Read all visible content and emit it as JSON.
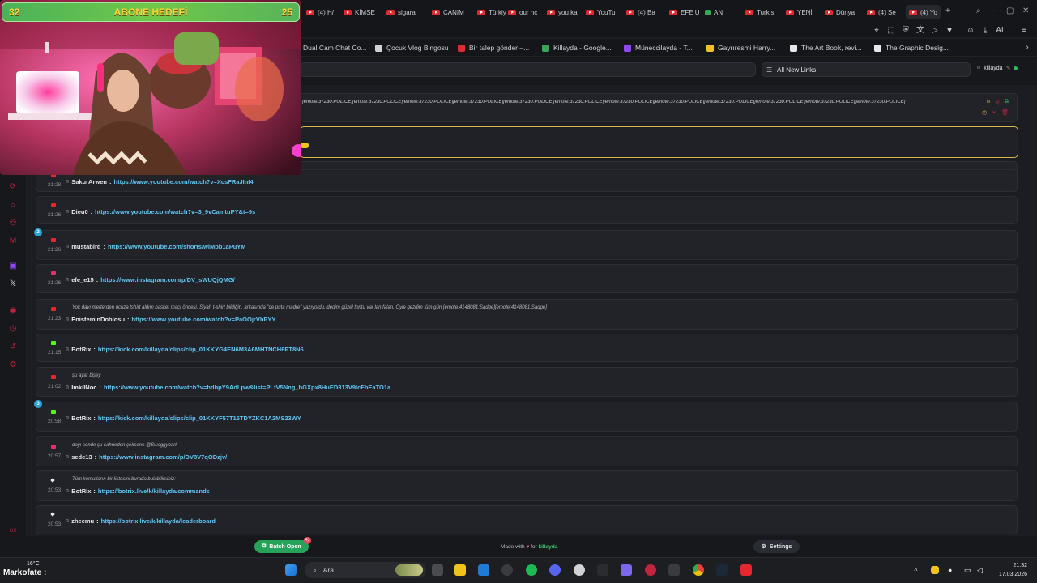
{
  "browser": {
    "tabs": [
      {
        "label": "(4) H/",
        "kind": "yt"
      },
      {
        "label": "KİMSE",
        "kind": "yt"
      },
      {
        "label": "sigara",
        "kind": "yt"
      },
      {
        "label": "CANIM",
        "kind": "yt"
      },
      {
        "label": "Türkiy",
        "kind": "yt"
      },
      {
        "label": "our nc",
        "kind": "yt"
      },
      {
        "label": "you ka",
        "kind": "yt"
      },
      {
        "label": "YouTu",
        "kind": "yt"
      },
      {
        "label": "(4) Ba",
        "kind": "yt"
      },
      {
        "label": "EFE U",
        "kind": "yt"
      },
      {
        "label": "AN",
        "kind": "other"
      },
      {
        "label": "Turkis",
        "kind": "yt"
      },
      {
        "label": "YENİ",
        "kind": "yt"
      },
      {
        "label": "Dünya",
        "kind": "yt"
      },
      {
        "label": "(4) Se",
        "kind": "yt"
      },
      {
        "label": "(4) Yo",
        "kind": "yt",
        "active": true
      }
    ],
    "new_tab": "+",
    "bookmarks": [
      {
        "label": "Dual Cam Chat Co...",
        "color": "#151619"
      },
      {
        "label": "Çocuk Vlog Bingosu",
        "color": "#cfd1d6"
      },
      {
        "label": "Bir talep gönder –...",
        "color": "#e4282d"
      },
      {
        "label": "Killayda - Google...",
        "color": "#34a853"
      },
      {
        "label": "Müneccilayda - T...",
        "color": "#9146ff"
      },
      {
        "label": "Gayrıresmi Harry...",
        "color": "#f0c419"
      },
      {
        "label": "The Art Book, revi...",
        "color": "#e8e8e8"
      },
      {
        "label": "The Graphic Desig...",
        "color": "#e8e8e8"
      }
    ]
  },
  "stream": {
    "goal_label": "ABONE HEDEFİ",
    "goal_current": "32",
    "goal_target": "25"
  },
  "app": {
    "search_placeholder": "",
    "filter_label": "All New Links",
    "username": "killayda",
    "top_card_text": "[emote:37230:POLICE][emote:37230:POLICE][emote:37230:POLICE][emote:37230:POLICE][emote:37230:POLICE][emote:37230:POLICE][emote:37230:POLICE][emote:37230:POLICE][emote:37230:POLICE][emote:37230:POLICE][emote:37230:POLICE][emote:37230:POLICE]",
    "cards": [
      {
        "time": "21:28",
        "user": "SakurArwen",
        "link": "https://www.youtube.com/watch?v=XcsFRaJInI4",
        "src": "yt"
      },
      {
        "time": "21:26",
        "user": "Dieu0",
        "link": "https://www.youtube.com/watch?v=3_9vCamtuPY&t=9s",
        "src": "yt"
      },
      {
        "time": "21:26",
        "user": "mustabird",
        "link": "https://www.youtube.com/shorts/wiMpb1aPuYM",
        "src": "yt",
        "badge": "2"
      },
      {
        "time": "21:26",
        "user": "efe_e15",
        "link": "https://www.instagram.com/p/DV_sWUQjQMG/",
        "src": "ig"
      },
      {
        "time": "21:23",
        "user": "EnistemìnDoblosu",
        "link": "https://www.youtube.com/watch?v=PaOOjrVhPYY",
        "src": "yt",
        "msg": "Yok dayı merterden ucuza tshirt aldım basket maçı öncesi. Siyah t-shirt bildiğin, arkasında \"de puta madre\" yazıyordu. dedim güzel fontu var lan falan. Öyle gezdim tüm gün [emote:4148081:Sadge][emote:4148081:Sadge]"
      },
      {
        "time": "21:15",
        "user": "BotRix",
        "link": "https://kick.com/killayda/clips/clip_01KKYG4EN6M3A6MHTNCH6PT8N6",
        "src": "kick"
      },
      {
        "time": "21:02",
        "user": "ImkiINoc",
        "link": "https://www.youtube.com/watch?v=hdbpY9AdLpw&list=PLtV5Nng_bGXpx8HuED313V9lcFbEaTO1a",
        "src": "yt",
        "msg": "şu ayar bişey"
      },
      {
        "time": "20:58",
        "user": "BotRix",
        "link": "https://kick.com/killayda/clips/clip_01KKYF57T15TDYZKC1A2MS23WY",
        "src": "kick",
        "badge": "3"
      },
      {
        "time": "20:57",
        "user": "sede13",
        "link": "https://www.instagram.com/p/DV8V7qODzjv/",
        "src": "ig",
        "msg": "dayı sende şu sahneden çeksene @Swaggybark"
      },
      {
        "time": "20:53",
        "user": "BotRix",
        "link": "https://botrix.live/k/killayda/commands",
        "src": "bot",
        "msg": "Tüm komutların bir listesini burada bulabilirsiniz:"
      },
      {
        "time": "20:53",
        "user": "zheemu",
        "link": "https://botrix.live/k/killayda/leaderboard",
        "src": "bot"
      }
    ],
    "footer": {
      "batch_label": "Batch Open",
      "batch_count": "43",
      "made_with_prefix": "Made with",
      "made_with_for": "for",
      "brand": "killayda",
      "settings_label": "Settings"
    }
  },
  "taskbar": {
    "weather": "16°C",
    "overlay_name": "Markofate :",
    "search_label": "Ara",
    "time": "21:32",
    "date": "17.03.2026"
  }
}
